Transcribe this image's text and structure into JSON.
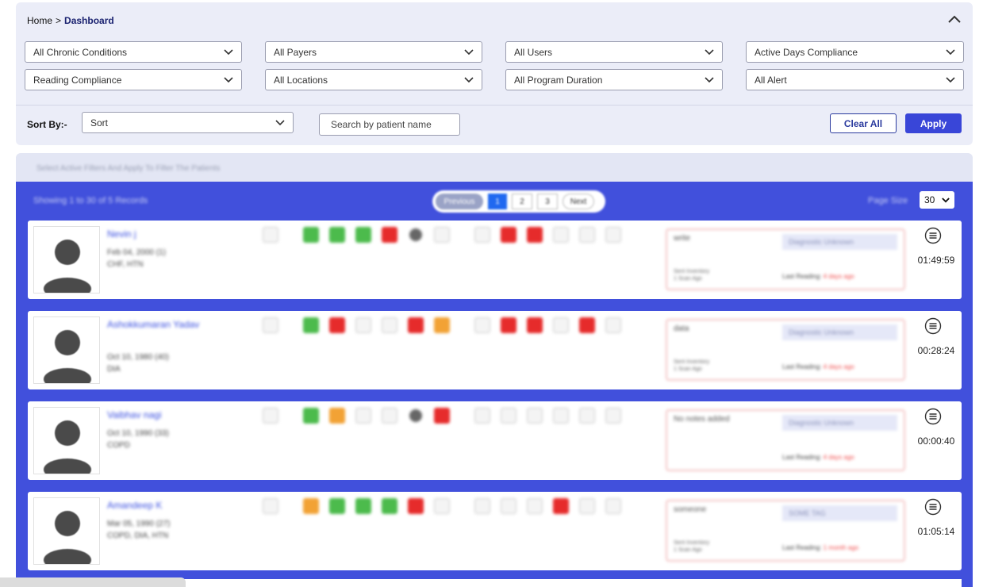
{
  "breadcrumb": {
    "home": "Home",
    "separator": ">",
    "current": "Dashboard"
  },
  "filters": {
    "row1": [
      "All Chronic Conditions",
      "All Payers",
      "All Users",
      "Active Days Compliance"
    ],
    "row2": [
      "Reading Compliance",
      "All Locations",
      "All Program Duration",
      "All Alert"
    ]
  },
  "sort": {
    "label": "Sort By:-",
    "value": "Sort"
  },
  "search": {
    "placeholder": "Search by patient name"
  },
  "buttons": {
    "clear": "Clear All",
    "apply": "Apply"
  },
  "info": "Select Active Filters And Apply To Filter The Patients",
  "list": {
    "showing": "Showing 1 to 30 of 5 Records",
    "pagination": {
      "previous": "Previous",
      "pages": [
        "1",
        "2",
        "3"
      ],
      "next": "Next"
    },
    "page_size_label": "Page Size",
    "page_size": "30"
  },
  "patients": [
    {
      "name": "Nevin j",
      "dob": "Feb 04, 2000 (1)",
      "conditions": "CHF, HTN",
      "note": "write",
      "tag": "Diagnostic Unknown",
      "meta1": "Sent Inventory",
      "meta2": "1 Scan Ago",
      "last_label": "Last Reading:",
      "last_value": "4 days ago",
      "timer": "01:49:59"
    },
    {
      "name": "Ashokkumaran Yadav",
      "dob": "Oct 10, 1980 (40)",
      "conditions": "DIA",
      "note": "data",
      "tag": "Diagnostic Unknown",
      "meta1": "Sent Inventory",
      "meta2": "1 Scan Ago",
      "last_label": "Last Reading:",
      "last_value": "4 days ago",
      "timer": "00:28:24"
    },
    {
      "name": "Vaibhav nagi",
      "dob": "Oct 10, 1990 (33)",
      "conditions": "COPD",
      "note": "No notes added",
      "tag": "Diagnostic Unknown",
      "meta1": "",
      "meta2": "",
      "last_label": "Last Reading:",
      "last_value": "4 days ago",
      "timer": "00:00:40"
    },
    {
      "name": "Amandeep K",
      "dob": "Mar 05, 1990 (27)",
      "conditions": "COPD, DIA, HTN",
      "note": "someone",
      "tag": "SOME TAG",
      "meta1": "Sent Inventory",
      "meta2": "1 Scan Ago",
      "last_label": "Last Reading:",
      "last_value": "1 month ago",
      "timer": "01:05:14"
    }
  ],
  "colors": {
    "primary": "#4150dc",
    "accent_button": "#3946d8",
    "panel_bg": "#ebedf8",
    "alert_red": "#e62b2b",
    "ok_green": "#4cbb4c",
    "warn_orange": "#f2a235"
  }
}
